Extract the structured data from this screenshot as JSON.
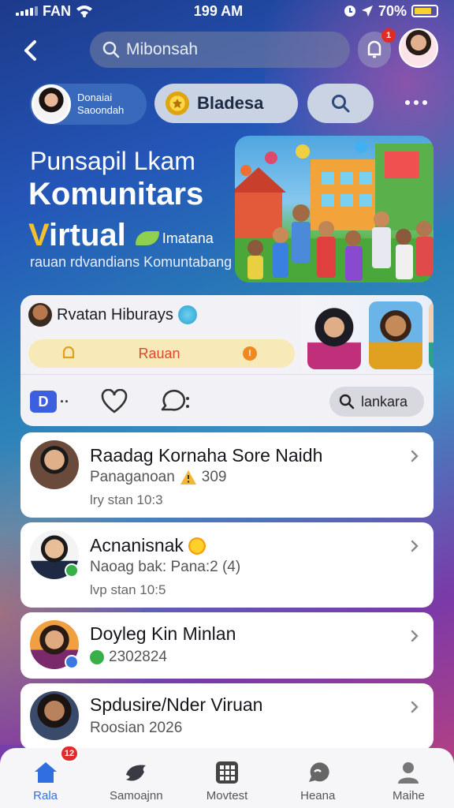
{
  "status_bar": {
    "carrier": "FAN",
    "time": "199 AM",
    "battery": "70%"
  },
  "header": {
    "search_value": "Mibonsah",
    "notification_badge": "1"
  },
  "chips": {
    "profile_line1": "Donaiai",
    "profile_line2": "Saoondah",
    "gold_label": "Bladesa"
  },
  "hero": {
    "line1": "Punsapil Lkam",
    "line2": "Komunitars",
    "line3_first": "V",
    "line3_rest": "irtual",
    "tag": "Imatana",
    "subtitle": "rauan rdvandians Komuntabang"
  },
  "community": {
    "title": "Rvatan Hiburays",
    "pill_label": "Rauan",
    "search_label": "lankara"
  },
  "list": [
    {
      "name": "Raadag Kornaha Sore Naidh",
      "sub": "Panaganoan",
      "sub_num": "309",
      "meta": "lry stan 10:3"
    },
    {
      "name": "Acnanisnak",
      "sub": "Naoag bak: Pana:2 (4)",
      "meta": "lvp stan 10:5"
    },
    {
      "name": "Doyleg Kin Minlan",
      "sub": "2302824"
    },
    {
      "name": "Spdusire/Nder Viruan",
      "sub": "Roosian 2026"
    }
  ],
  "nav": [
    {
      "label": "Rala",
      "icon": "home-icon",
      "badge": "12"
    },
    {
      "label": "Samoajnn",
      "icon": "bird-icon"
    },
    {
      "label": "Movtest",
      "icon": "grid-icon"
    },
    {
      "label": "Heana",
      "icon": "chat-bubble-icon"
    },
    {
      "label": "Maihe",
      "icon": "person-icon"
    }
  ],
  "colors": {
    "accent": "#2f6fe0",
    "gold": "#f4c12e",
    "badge": "#e02b2b",
    "link_red": "#d84a2a"
  }
}
